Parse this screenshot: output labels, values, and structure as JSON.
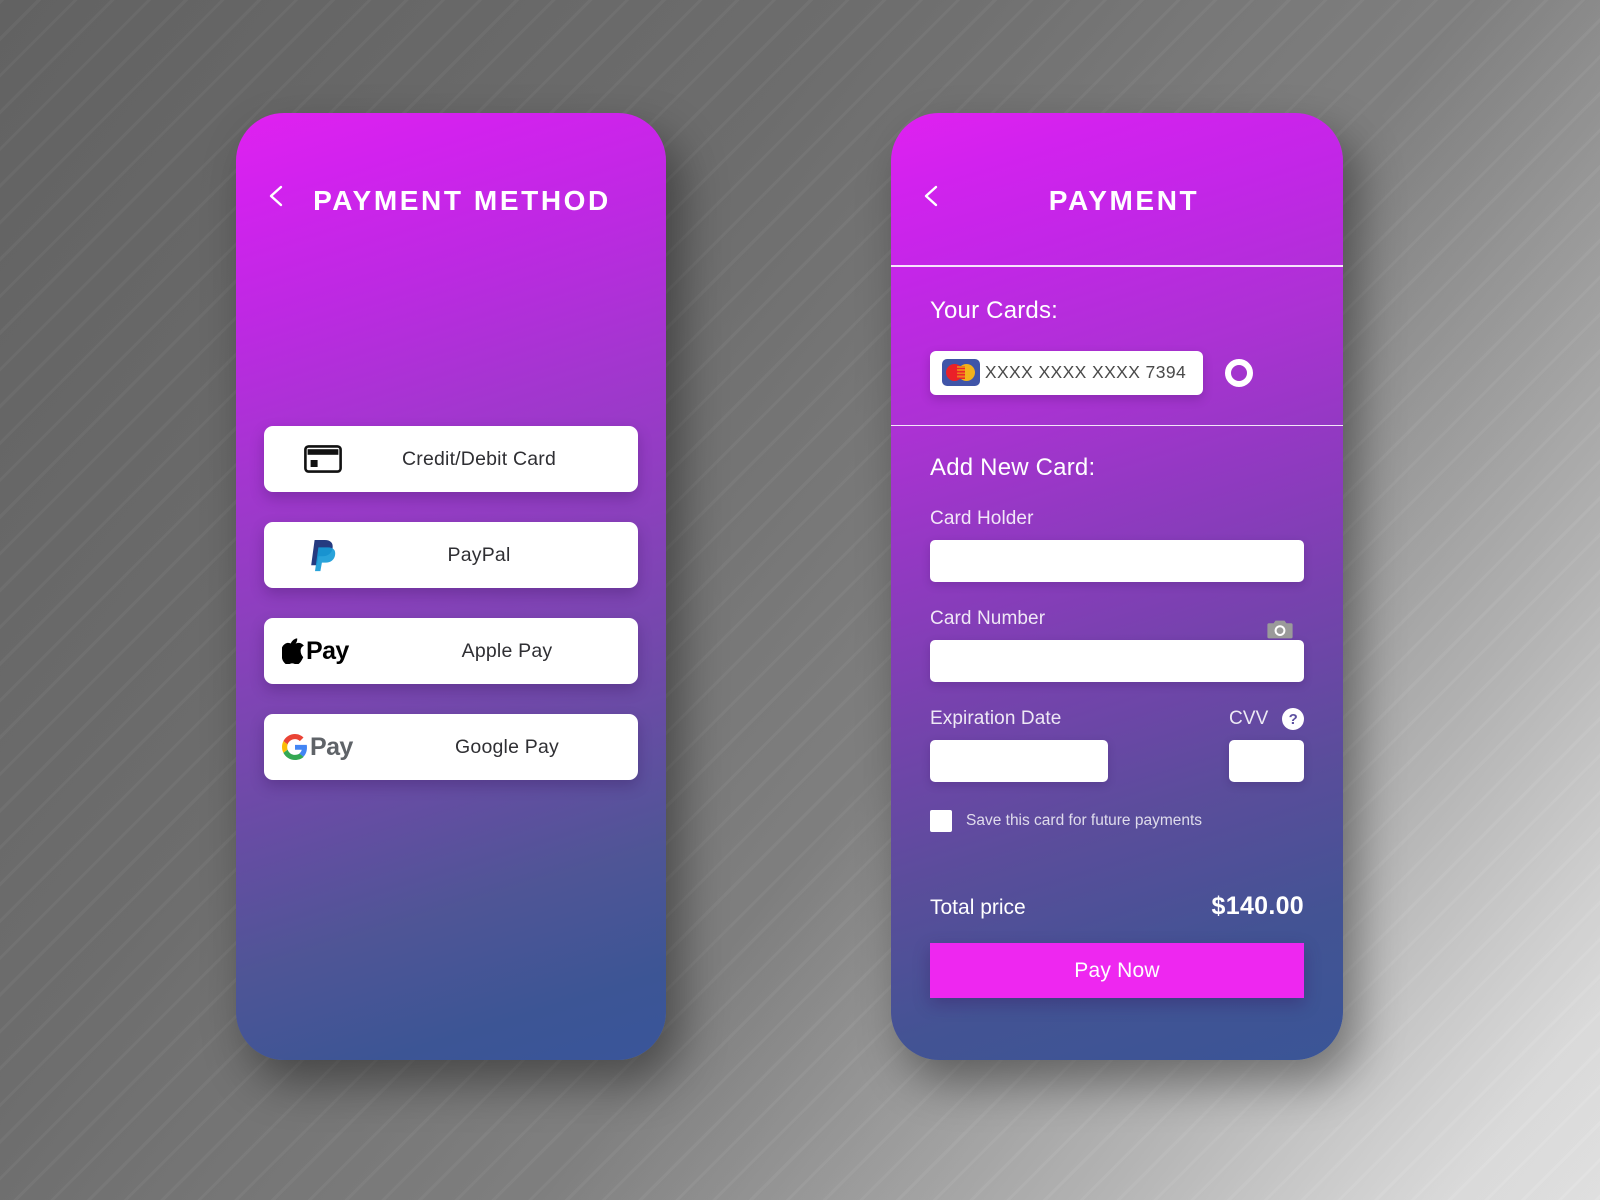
{
  "screens": {
    "left": {
      "title": "PAYMENT METHOD",
      "back_icon": "chevron-left-icon",
      "options": [
        {
          "label": "Credit/Debit Card",
          "logo": "credit-card-icon"
        },
        {
          "label": "PayPal",
          "logo": "paypal-logo"
        },
        {
          "label": "Apple Pay",
          "logo": "apple-pay-logo",
          "wordmark": "Pay"
        },
        {
          "label": "Google Pay",
          "logo": "google-pay-logo",
          "wordmark": "Pay"
        }
      ]
    },
    "right": {
      "title": "PAYMENT",
      "back_icon": "chevron-left-icon",
      "your_cards": {
        "heading": "Your Cards:",
        "card": {
          "brand_icon": "mastercard-logo",
          "number": "XXXX XXXX XXXX 7394",
          "selected": true
        }
      },
      "add_new_card": {
        "heading": "Add New Card:",
        "card_holder": {
          "label": "Card Holder",
          "value": "",
          "placeholder": ""
        },
        "card_number": {
          "label": "Card Number",
          "value": "",
          "placeholder": "",
          "scan_icon": "camera-icon"
        },
        "expiration_date": {
          "label": "Expiration Date",
          "value": "",
          "placeholder": ""
        },
        "cvv": {
          "label": "CVV",
          "value": "",
          "placeholder": "",
          "help_icon": "question-mark-icon",
          "help_glyph": "?"
        },
        "save_card": {
          "label": "Save this card for future payments",
          "checked": false
        }
      },
      "summary": {
        "total_label": "Total price",
        "total_value": "$140.00",
        "pay_button": "Pay Now"
      }
    }
  },
  "colors": {
    "gradient_start": "#e021f0",
    "gradient_end": "#3a5596",
    "accent_magenta": "#ee27f0",
    "card_white": "#ffffff",
    "mastercard_bg": "#4055a8",
    "mastercard_red": "#eb2028",
    "mastercard_yellow": "#f2b21b"
  }
}
